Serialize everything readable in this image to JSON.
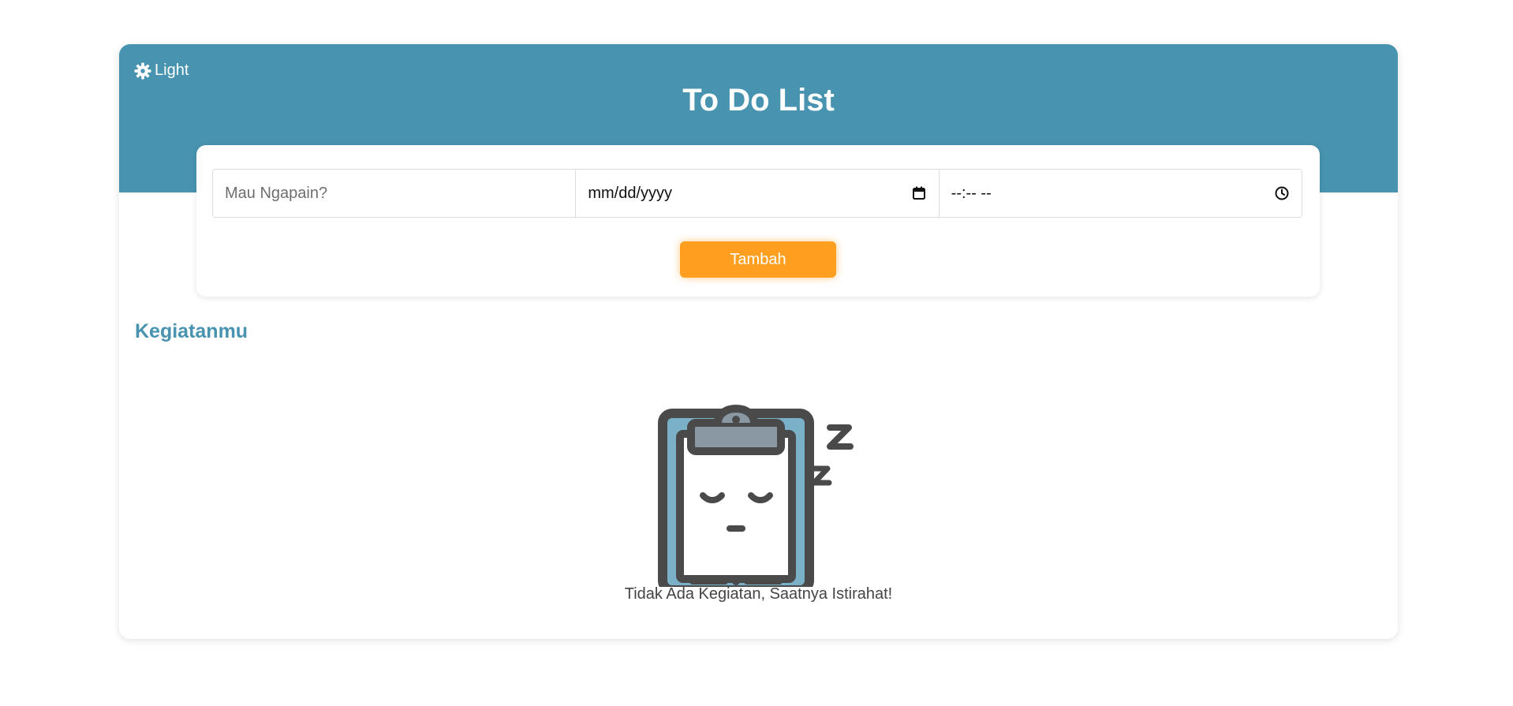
{
  "header": {
    "theme_label": "Light",
    "theme_icon": "gear-icon",
    "title": "To Do List",
    "background_color": "#4793b0"
  },
  "form": {
    "task_placeholder": "Mau Ngapain?",
    "date_value": "mm/dd/yyyy",
    "date_icon": "calendar-icon",
    "time_value": "--:-- --",
    "time_icon": "clock-icon",
    "add_button_label": "Tambah",
    "add_button_color": "#ff9f1f"
  },
  "activities": {
    "section_title": "Kegiatanmu",
    "empty_icon": "sleeping-clipboard-icon",
    "empty_message": "Tidak Ada Kegiatan, Saatnya Istirahat!"
  }
}
